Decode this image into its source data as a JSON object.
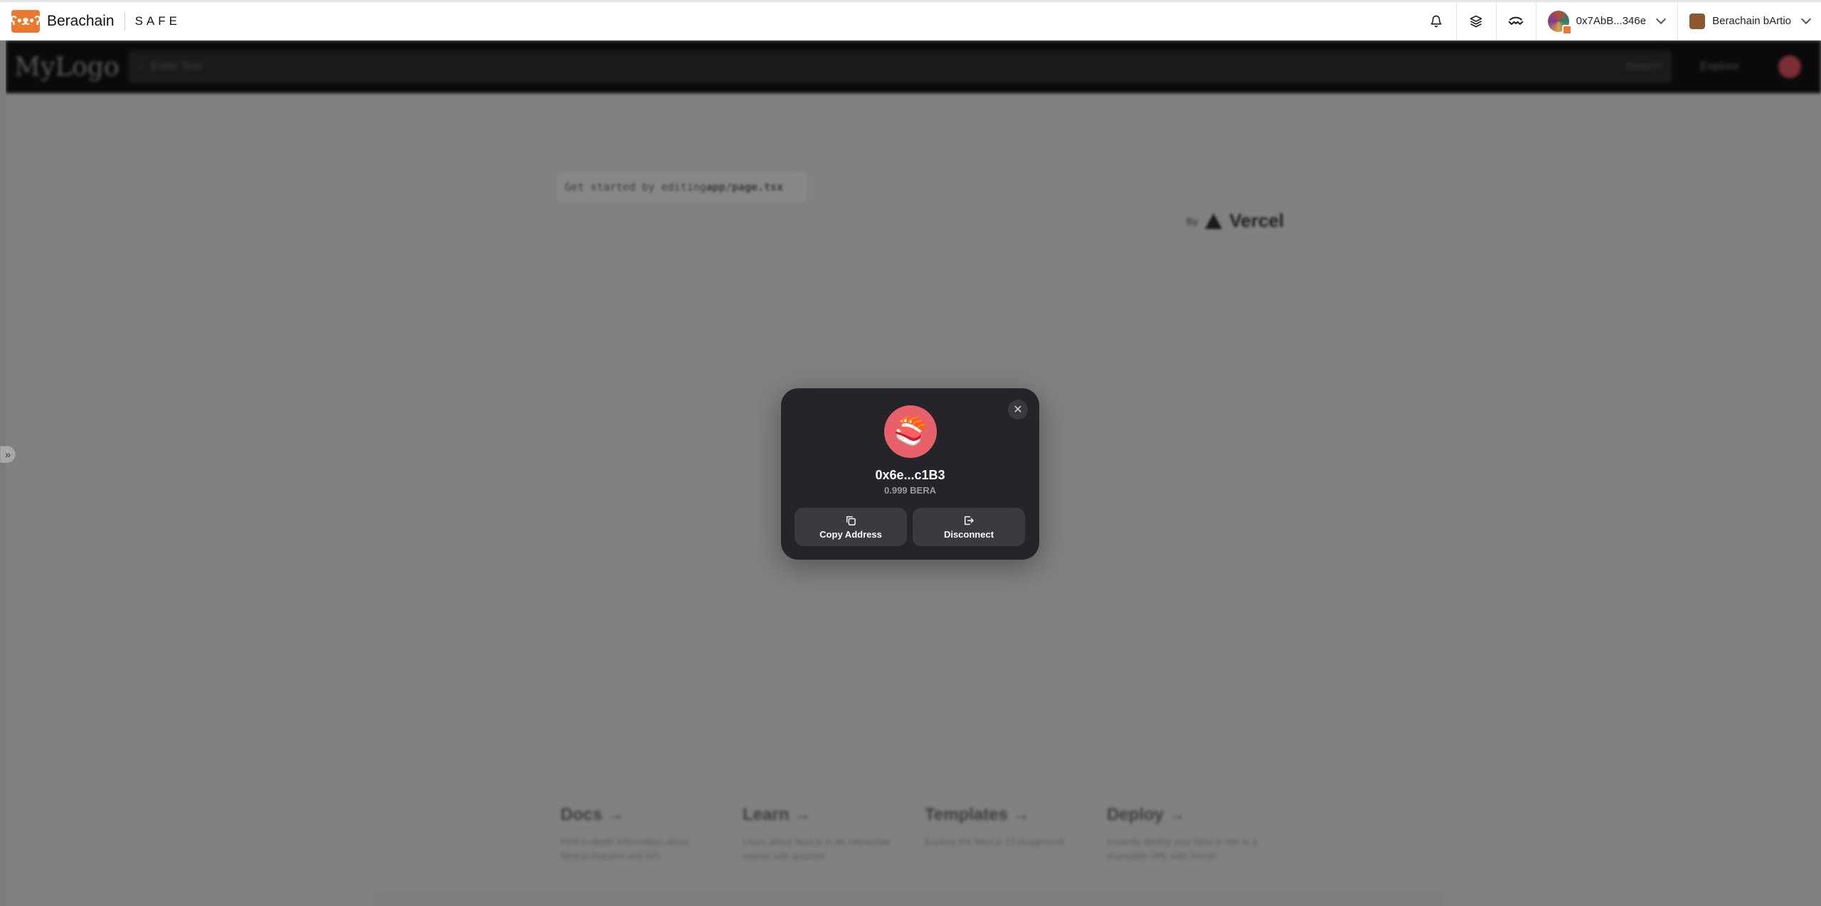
{
  "safe_header": {
    "brand_name": "Berachain",
    "product": "SAFE",
    "account_address": "0x7AbB...346e",
    "network_name": "Berachain bArtio",
    "icons": [
      "bell-icon",
      "layers-icon",
      "walletconnect-icon",
      "chevron-down-icon"
    ]
  },
  "app": {
    "logo": "MyLogo",
    "search_placeholder": "Enter Text",
    "search_button": "Search",
    "explore_label": "Explore",
    "getstarted_prefix": "Get started by editing ",
    "getstarted_file": "app/page.tsx",
    "by_label": "By",
    "vercel_label": "Vercel",
    "cards": [
      {
        "title": "Docs →",
        "text": "Find in-depth information about Next.js features and API."
      },
      {
        "title": "Learn →",
        "text": "Learn about Next.js in an interactive course with quizzes!"
      },
      {
        "title": "Templates →",
        "text": "Explore the Next.js 13 playground."
      },
      {
        "title": "Deploy →",
        "text": "Instantly deploy your Next.js site to a shareable URL with Vercel."
      }
    ]
  },
  "modal": {
    "address": "0x6e...c1B3",
    "balance": "0.999 BERA",
    "copy_label": "Copy Address",
    "disconnect_label": "Disconnect",
    "avatar_emoji": "🍣"
  },
  "colors": {
    "brand_orange": "#e8792e",
    "modal_bg": "#252529",
    "modal_button_bg": "#3a3a3f",
    "avatar_pink": "#e8616a"
  }
}
